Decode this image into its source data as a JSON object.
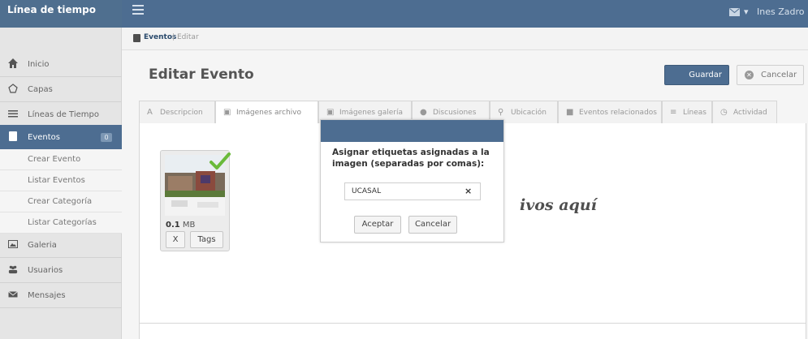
{
  "app": {
    "title": "Línea de tiempo"
  },
  "topbar": {
    "user_name": "Ines Zadro",
    "mail_icon": "envelope-icon",
    "caret": "▾"
  },
  "sidebar": {
    "items": [
      {
        "label": "Inicio",
        "icon": "home-icon"
      },
      {
        "label": "Capas",
        "icon": "layers-icon"
      },
      {
        "label": "Líneas de Tiempo",
        "icon": "list-icon"
      },
      {
        "label": "Eventos",
        "icon": "document-icon",
        "badge": "0",
        "active": true
      },
      {
        "label": "Galeria",
        "icon": "image-icon"
      },
      {
        "label": "Usuarios",
        "icon": "users-icon"
      },
      {
        "label": "Mensajes",
        "icon": "envelope-icon"
      }
    ],
    "subitems": [
      {
        "label": "Crear Evento"
      },
      {
        "label": "Listar Eventos"
      },
      {
        "label": "Crear Categoría"
      },
      {
        "label": "Listar Categorías"
      }
    ]
  },
  "breadcrumb": {
    "parent": "Eventos",
    "separator": "|",
    "current": "Editar"
  },
  "page": {
    "title": "Editar Evento",
    "save_label": "Guardar",
    "cancel_label": "Cancelar"
  },
  "tabs": [
    {
      "label": "Descripcion",
      "icon": "text-icon"
    },
    {
      "label": "Imágenes archivo",
      "icon": "image-icon",
      "active": true
    },
    {
      "label": "Imágenes galería",
      "icon": "image-icon"
    },
    {
      "label": "Discusiones",
      "icon": "comments-icon"
    },
    {
      "label": "Ubicación",
      "icon": "map-marker-icon"
    },
    {
      "label": "Eventos relacionados",
      "icon": "document-icon"
    },
    {
      "label": "Líneas",
      "icon": "list-icon"
    },
    {
      "label": "Actividad",
      "icon": "clock-icon"
    }
  ],
  "upload": {
    "drop_text": "ivos aquí",
    "file": {
      "size_value": "0.1",
      "size_unit": "MB",
      "remove_label": "X",
      "tags_label": "Tags"
    }
  },
  "modal": {
    "message": "Asignar etiquetas asignadas a la imagen (separadas por comas):",
    "tag_value": "UCASAL",
    "tag_remove": "×",
    "ok_label": "Aceptar",
    "cancel_label": "Cancelar"
  },
  "colors": {
    "primary": "#4d6d91",
    "sidebar_bg": "#e5e5e5",
    "check": "#6aba3a"
  }
}
